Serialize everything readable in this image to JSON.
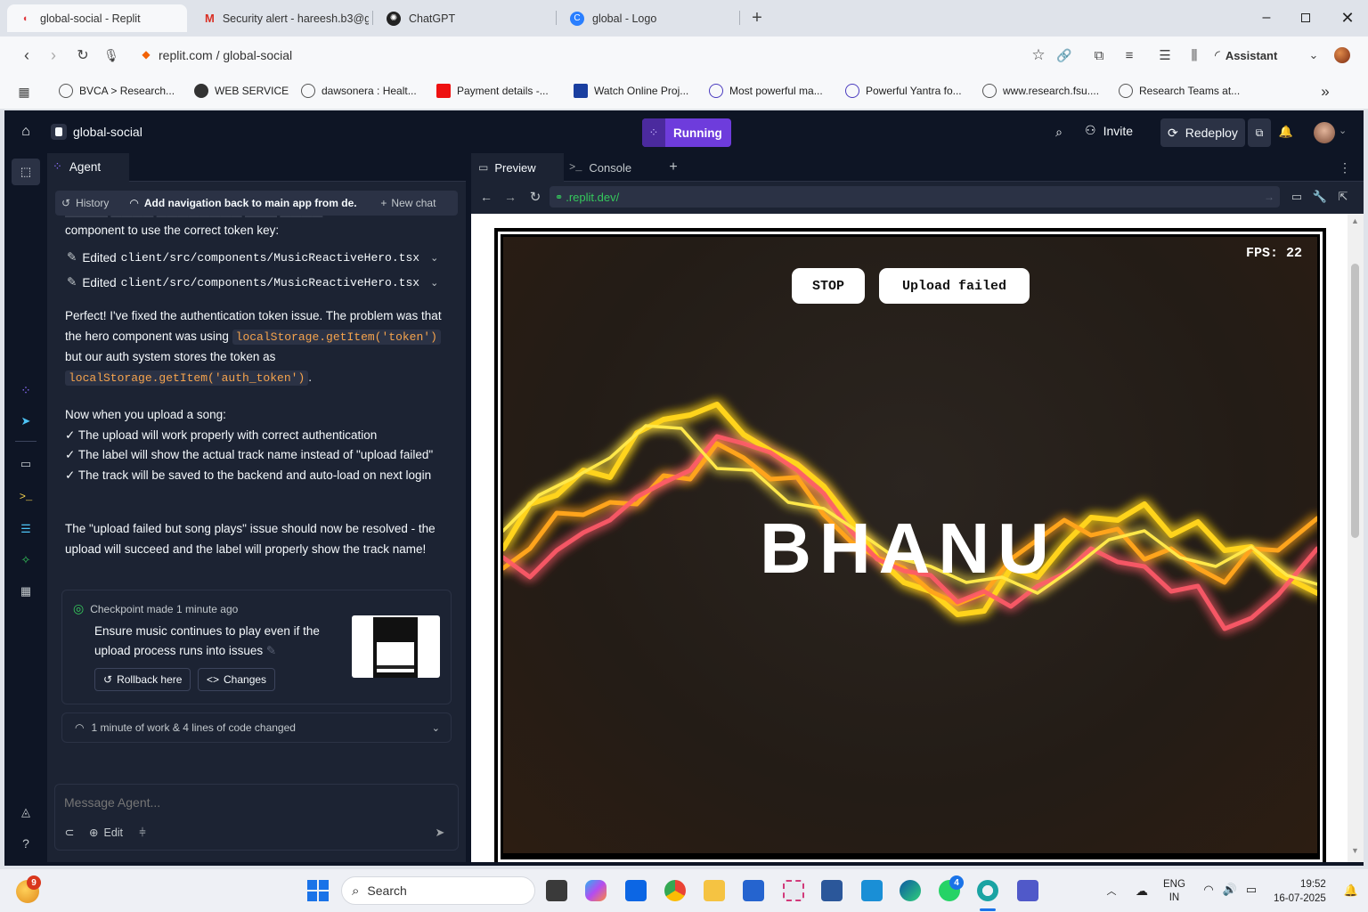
{
  "browser": {
    "tabs": [
      {
        "title": "global-social - Replit"
      },
      {
        "title": "Security alert - hareesh.b3@g"
      },
      {
        "title": "ChatGPT"
      },
      {
        "title": "global - Logo"
      }
    ],
    "url": "replit.com / global-social",
    "assistant_label": "Assistant",
    "bookmarks": [
      "BVCA > Research...",
      "WEB SERVICE",
      "dawsonera : Healt...",
      "Payment details -...",
      "Watch Online Proj...",
      "Most powerful ma...",
      "Powerful Yantra fo...",
      "www.research.fsu....",
      "Research Teams at..."
    ]
  },
  "replit": {
    "project_name": "global-social",
    "run_status": "Running",
    "invite_label": "Invite",
    "redeploy_label": "Redeploy",
    "agent_tab": "Agent",
    "history_label": "History",
    "chat_title": "Add navigation back to main app from de...",
    "new_chat_label": "New chat",
    "chat": {
      "intro": "component to use the correct token key:",
      "edits": [
        {
          "label": "Edited",
          "file": "client/src/components/MusicReactiveHero.tsx"
        },
        {
          "label": "Edited",
          "file": "client/src/components/MusicReactiveHero.tsx"
        }
      ],
      "p1_a": "Perfect! I've fixed the authentication token issue. The problem was that the hero component was using",
      "p1_code1": "localStorage.getItem('token')",
      "p1_b": "but our auth system stores the token as",
      "p1_code2": "localStorage.getItem('auth_token')",
      "p1_c": ".",
      "p2_title": "Now when you upload a song:",
      "bullets": [
        "✓ The upload will work properly with correct authentication",
        "✓ The label will show the actual track name instead of \"upload failed\"",
        "✓ The track will be saved to the backend and auto-load on next login"
      ],
      "p3": "The \"upload failed but song plays\" issue should now be resolved - the upload will succeed and the label will properly show the track name!",
      "checkpoint_label": "Checkpoint made 1 minute ago",
      "checkpoint_desc": "Ensure music continues to play even if the upload process runs into issues",
      "rollback_label": "Rollback here",
      "changes_label": "Changes",
      "work_summary": "1 minute of work & 4 lines of code changed"
    },
    "message_placeholder": "Message Agent...",
    "edit_label": "Edit",
    "preview_tab": "Preview",
    "console_tab": "Console",
    "preview_url": ".replit.dev/",
    "app": {
      "fps": "FPS: 22",
      "stop_label": "STOP",
      "upload_label": "Upload failed",
      "hero_title": "BHANU"
    }
  },
  "taskbar": {
    "search_placeholder": "Search",
    "lang": "ENG",
    "region": "IN",
    "time": "19:52",
    "date": "16-07-2025",
    "weather_badge": "9",
    "whatsapp_badge": "4"
  },
  "colors": {
    "replit_bg": "#0e1525",
    "panel": "#1c2333",
    "running": "#6e3cdc",
    "accent_code": "#f5a34d"
  }
}
